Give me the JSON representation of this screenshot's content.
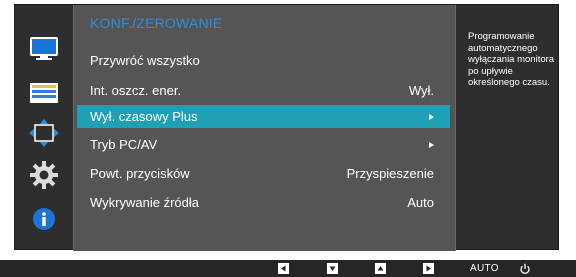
{
  "menu": {
    "title": "KONF./ZEROWANIE",
    "items": [
      {
        "label": "Przywróć wszystko",
        "value": "",
        "arrow": false,
        "active": false
      },
      {
        "label": "Int. oszcz. ener.",
        "value": "Wył.",
        "arrow": false,
        "active": false
      },
      {
        "label": "Wył. czasowy Plus",
        "value": "",
        "arrow": true,
        "active": true
      },
      {
        "label": "Tryb PC/AV",
        "value": "",
        "arrow": true,
        "active": false
      },
      {
        "label": "Powt. przycisków",
        "value": "Przyspieszenie",
        "arrow": false,
        "active": false
      },
      {
        "label": "Wykrywanie źródła",
        "value": "Auto",
        "arrow": false,
        "active": false
      }
    ]
  },
  "help": {
    "text": "Programowanie automatycznego wyłączania monitora po upływie określonego czasu."
  },
  "sidebar": {
    "icons": [
      "picture-icon",
      "onscreen-display-icon",
      "position-icon",
      "setup-gear-icon",
      "information-icon"
    ]
  },
  "bottom_bar": {
    "buttons": [
      "left-button",
      "down-button",
      "up-button",
      "enter-button"
    ],
    "auto_label": "AUTO",
    "power_label": "power-icon"
  },
  "colors": {
    "accent": "#1fa0b4",
    "title": "#2a8fe0",
    "menu_bg": "#555555",
    "frame_bg": "#2e2e2e"
  }
}
